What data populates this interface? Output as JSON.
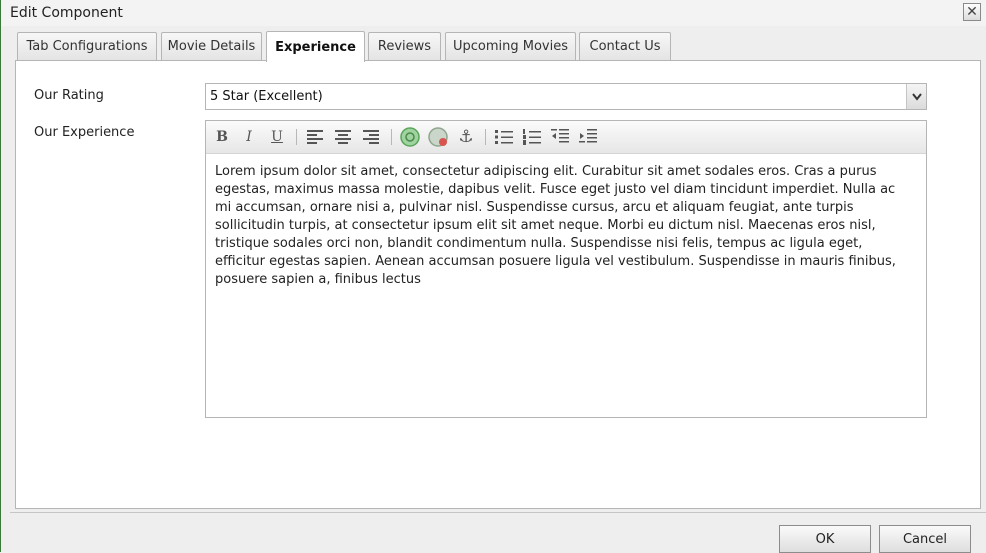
{
  "window": {
    "title": "Edit Component",
    "close_symbol": "✕"
  },
  "tabs": [
    {
      "label": "Tab Configurations",
      "active": false
    },
    {
      "label": "Movie Details",
      "active": false
    },
    {
      "label": "Experience",
      "active": true
    },
    {
      "label": "Reviews",
      "active": false
    },
    {
      "label": "Upcoming Movies",
      "active": false
    },
    {
      "label": "Contact Us",
      "active": false
    }
  ],
  "form": {
    "rating_label": "Our Rating",
    "rating_value": "5 Star (Excellent)",
    "experience_label": "Our Experience",
    "experience_text": "Lorem ipsum dolor sit amet, consectetur adipiscing elit. Curabitur sit amet sodales eros. Cras a purus egestas, maximus massa molestie, dapibus velit. Fusce eget justo vel diam tincidunt imperdiet. Nulla ac mi accumsan, ornare nisi a, pulvinar nisl. Suspendisse cursus, arcu et aliquam feugiat, ante turpis sollicitudin turpis, at consectetur ipsum elit sit amet neque. Morbi eu dictum nisl. Maecenas eros nisl, tristique sodales orci non, blandit condimentum nulla. Suspendisse nisi felis, tempus ac ligula eget, efficitur egestas sapien. Aenean accumsan posuere ligula vel vestibulum. Suspendisse in mauris finibus, posuere sapien a, finibus lectus"
  },
  "toolbar": {
    "bold": "B",
    "italic": "I",
    "underline": "U",
    "anchor": "⚓"
  },
  "footer": {
    "ok_label": "OK",
    "cancel_label": "Cancel"
  },
  "colors": {
    "window_bg": "#eeeeee",
    "panel_bg": "#ffffff",
    "border": "#b5b5b5",
    "link_icon": "#5aa55a",
    "unlink_icon": "#d9534f"
  }
}
